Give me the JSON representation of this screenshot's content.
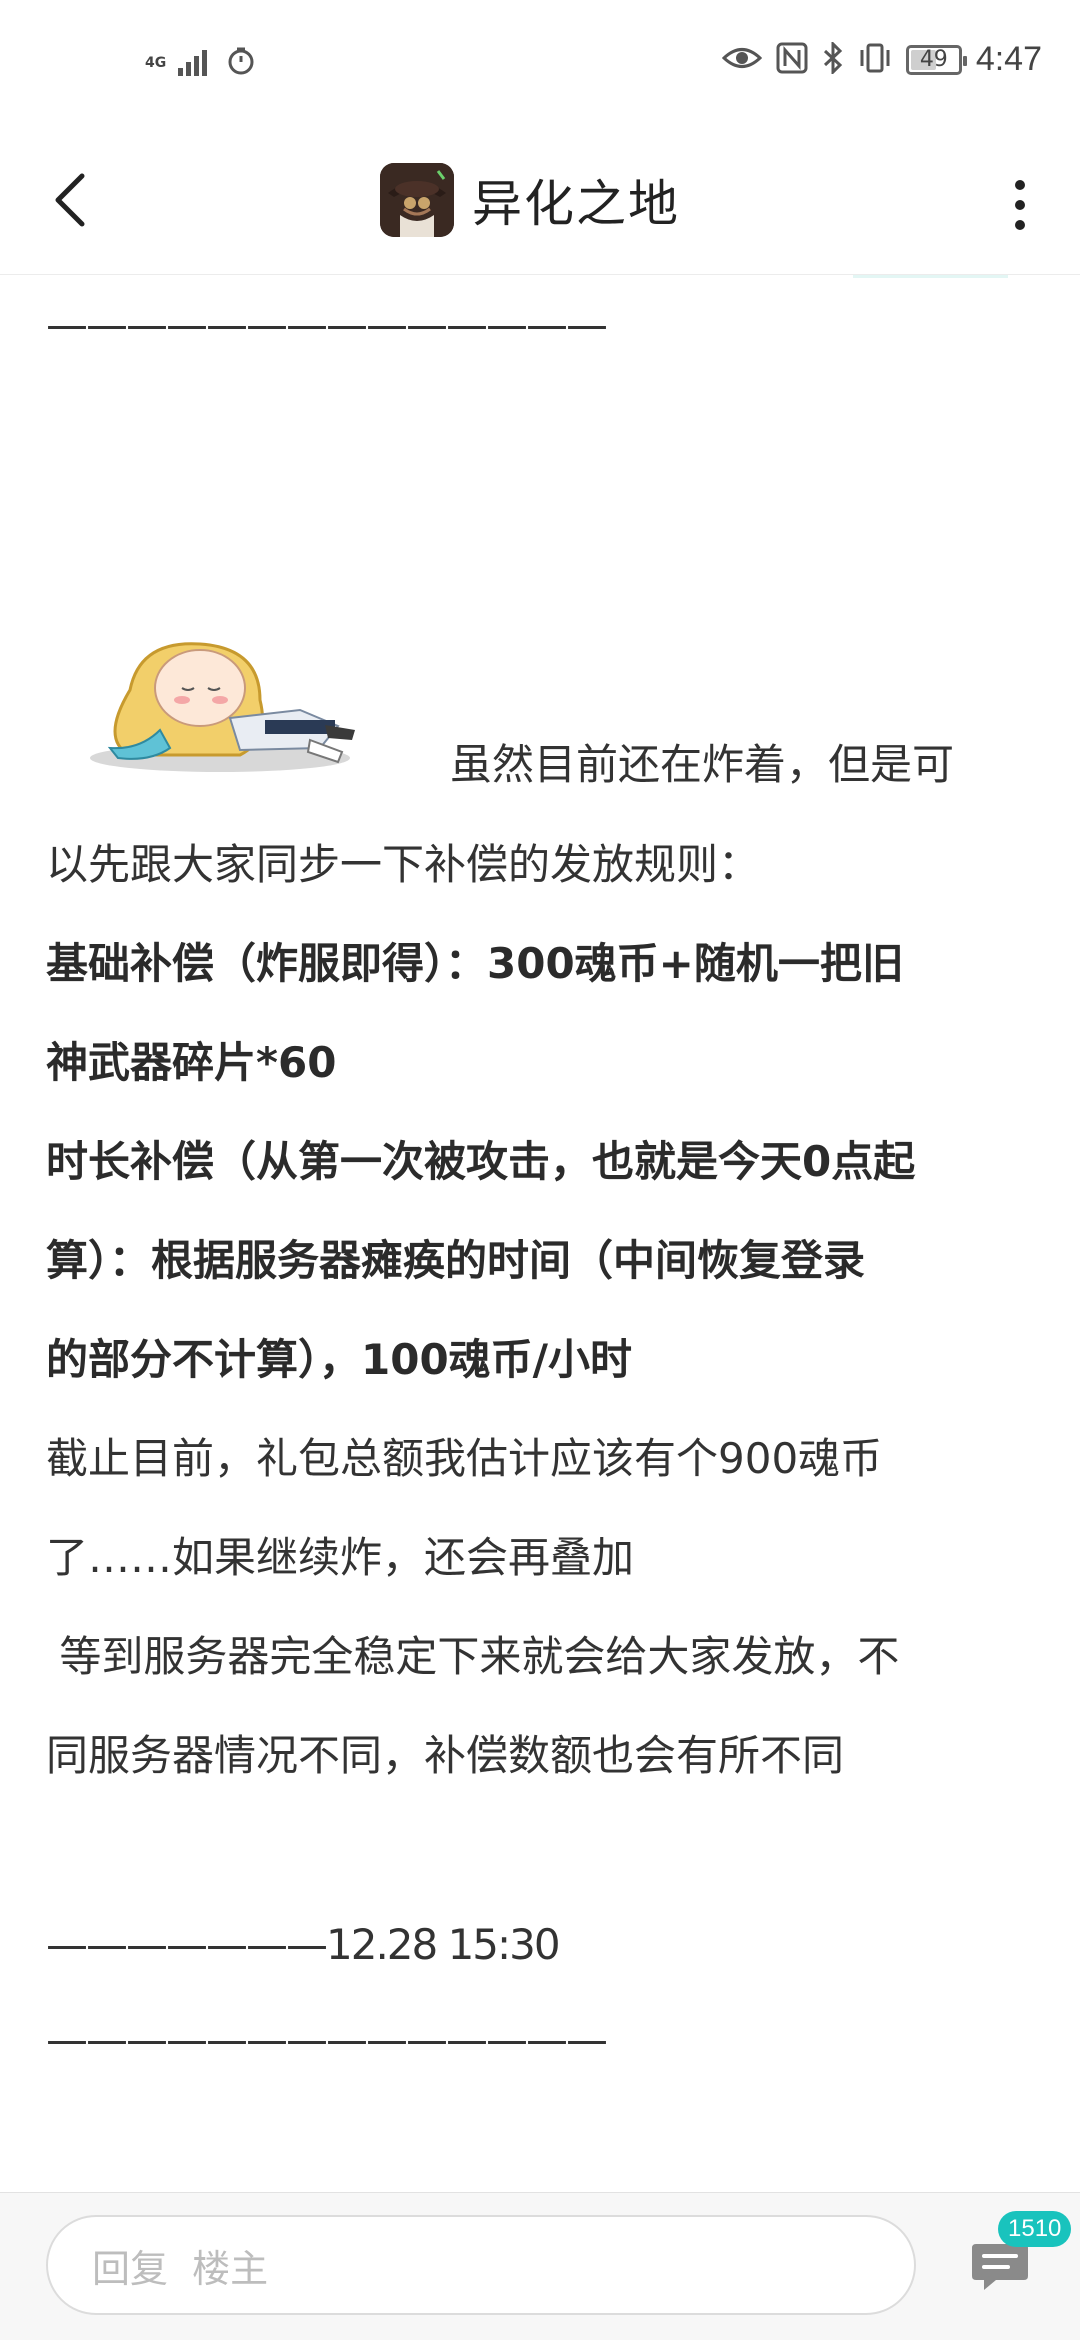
{
  "status_bar": {
    "network": "4G",
    "battery": "49",
    "time": "4:47"
  },
  "nav": {
    "title": "异化之地"
  },
  "post": {
    "top_divider": "——————————————",
    "intro_first_line": "虽然目前还在炸着，但是可",
    "intro_second_line": "以先跟大家同步一下补偿的发放规则：",
    "basic_line1": "基础补偿（炸服即得）：300魂币+随机一把旧",
    "basic_line2": "神武器碎片*60",
    "duration_line1": "时长补偿（从第一次被攻击，也就是今天0点起",
    "duration_line2": "算）：根据服务器瘫痪的时间（中间恢复登录",
    "duration_line3": "的部分不计算），100魂币/小时",
    "estimate_line1": "截止目前，礼包总额我估计应该有个900魂币",
    "estimate_line2": "了……如果继续炸，还会再叠加",
    "release_line1": " 等到服务器完全稳定下来就会给大家发放，不",
    "release_line2": "同服务器情况不同，补偿数额也会有所不同",
    "timestamp_divider": "———————12.28 15:30",
    "bottom_divider": "——————————————"
  },
  "reply_bar": {
    "placeholder": "回复  楼主",
    "comment_count": "1510"
  },
  "colors": {
    "accent": "#19c3bd",
    "text": "#333333"
  }
}
